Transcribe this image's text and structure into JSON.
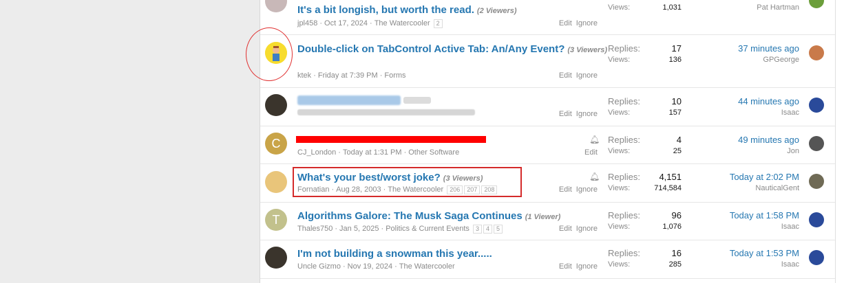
{
  "rows": [
    {
      "title": "It's a bit longish, but worth the read.",
      "viewers": "(2 Viewers)",
      "author": "jpl458",
      "date": "Oct 17, 2024",
      "forum": "The Watercooler",
      "pages": [
        "2"
      ],
      "actions": [
        "Edit",
        "Ignore"
      ],
      "replies_label": "Replies:",
      "replies": "",
      "views_label": "Views:",
      "views": "1,031",
      "last_time": "",
      "last_user": "Pat Hartman"
    },
    {
      "title": "Double-click on TabControl Active Tab: An/Any Event?",
      "viewers": "(3 Viewers)",
      "author": "ktek",
      "date": "Friday at 7:39 PM",
      "forum": "Forms",
      "actions": [
        "Edit",
        "Ignore"
      ],
      "replies_label": "Replies:",
      "replies": "17",
      "views_label": "Views:",
      "views": "136",
      "last_time": "37 minutes ago",
      "last_user": "GPGeorge"
    },
    {
      "title": "",
      "viewers": "",
      "author": "",
      "date": "",
      "forum": "",
      "actions": [
        "Edit",
        "Ignore"
      ],
      "replies_label": "Replies:",
      "replies": "10",
      "views_label": "Views:",
      "views": "157",
      "last_time": "44 minutes ago",
      "last_user": "Isaac"
    },
    {
      "title": "",
      "viewers": "",
      "avatar_letter": "C",
      "author": "CJ_London",
      "date": "Today at 1:31 PM",
      "forum": "Other Software",
      "actions": [
        "Edit"
      ],
      "replies_label": "Replies:",
      "replies": "4",
      "views_label": "Views:",
      "views": "25",
      "last_time": "49 minutes ago",
      "last_user": "Jon"
    },
    {
      "title": "What's your best/worst joke?",
      "viewers": "(3 Viewers)",
      "author": "Fornatian",
      "date": "Aug 28, 2003",
      "forum": "The Watercooler",
      "pages": [
        "206",
        "207",
        "208"
      ],
      "actions": [
        "Edit",
        "Ignore"
      ],
      "replies_label": "Replies:",
      "replies": "4,151",
      "views_label": "Views:",
      "views": "714,584",
      "last_time": "Today at 2:02 PM",
      "last_user": "NauticalGent"
    },
    {
      "title": "Algorithms Galore: The Musk Saga Continues",
      "viewers": "(1 Viewer)",
      "avatar_letter": "T",
      "author": "Thales750",
      "date": "Jan 5, 2025",
      "forum": "Politics & Current Events",
      "pages": [
        "3",
        "4",
        "5"
      ],
      "actions": [
        "Edit",
        "Ignore"
      ],
      "replies_label": "Replies:",
      "replies": "96",
      "views_label": "Views:",
      "views": "1,076",
      "last_time": "Today at 1:58 PM",
      "last_user": "Isaac"
    },
    {
      "title": "I'm not building a snowman this year.....",
      "viewers": "",
      "author": "Uncle Gizmo",
      "date": "Nov 19, 2024",
      "forum": "The Watercooler",
      "actions": [
        "Edit",
        "Ignore"
      ],
      "replies_label": "Replies:",
      "replies": "16",
      "views_label": "Views:",
      "views": "285",
      "last_time": "Today at 1:53 PM",
      "last_user": "Isaac"
    }
  ],
  "colors": {
    "link": "#2577b1",
    "muted": "#8a8a8a",
    "annotation": "#e03030"
  },
  "icons": {
    "bell": "bell-icon"
  }
}
